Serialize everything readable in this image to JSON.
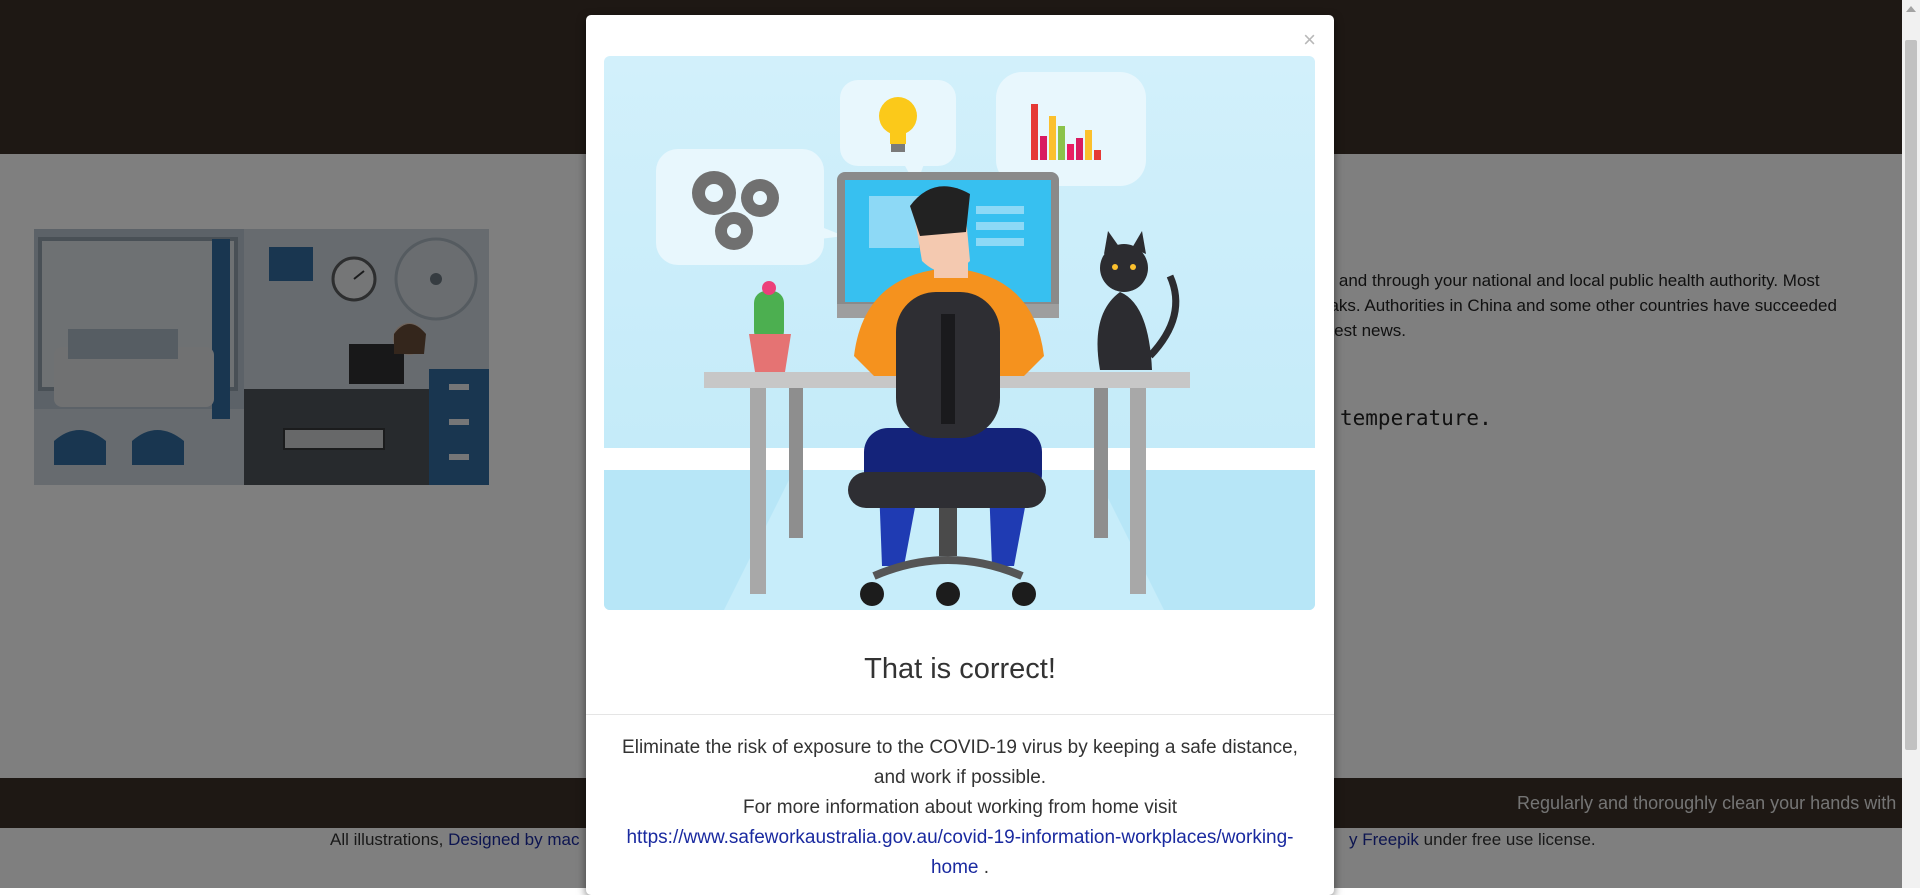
{
  "background": {
    "paragraph_lines": [
      "te and through your national and local public health authority. Most",
      "eaks. Authorities in China and some other countries have succeeded",
      "atest news."
    ],
    "heading_fragment": "temperature.",
    "ticker_text": "Regularly and thoroughly clean your hands with a",
    "credits": {
      "prefix": "All illustrations,",
      "designed_by_link": "Designed by mac",
      "freepik_link": "y Freepik",
      "suffix": "under free use license."
    }
  },
  "modal": {
    "close_label": "×",
    "title": "That is correct!",
    "body_line1": "Eliminate the risk of exposure to the COVID-19 virus by keeping a safe distance, and work if possible.",
    "body_line2": "For more information about working from home visit",
    "link_text": "https://www.safeworkaustralia.gov.au/covid-19-information-workplaces/working-home",
    "link_suffix": "."
  },
  "colors": {
    "header_bg": "#3d3128",
    "overlay": "rgba(0,0,0,0.5)",
    "link": "#1a2aa0",
    "sky": "#c8ecfa",
    "shirt": "#f5921e"
  },
  "icons": [
    "close-icon",
    "gear-icon",
    "lightbulb-icon",
    "bar-chart-icon",
    "cactus-icon",
    "cat-icon"
  ]
}
